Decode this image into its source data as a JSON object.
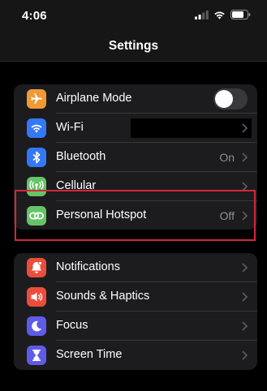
{
  "status_bar": {
    "time": "4:06"
  },
  "nav": {
    "title": "Settings"
  },
  "group1": [
    {
      "name": "airplane-mode",
      "label": "Airplane Mode",
      "icon": "airplane-icon",
      "color": "#f09a37",
      "toggle": false
    },
    {
      "name": "wifi",
      "label": "Wi-Fi",
      "icon": "wifi-icon",
      "color": "#3478f6",
      "value": ""
    },
    {
      "name": "bluetooth",
      "label": "Bluetooth",
      "icon": "bluetooth-icon",
      "color": "#3478f6",
      "value": "On"
    },
    {
      "name": "cellular",
      "label": "Cellular",
      "icon": "cellular-icon",
      "color": "#65c466"
    },
    {
      "name": "personal-hotspot",
      "label": "Personal Hotspot",
      "icon": "hotspot-icon",
      "color": "#65c466",
      "value": "Off"
    }
  ],
  "group2": [
    {
      "name": "notifications",
      "label": "Notifications",
      "icon": "bell-icon",
      "color": "#eb4d3d"
    },
    {
      "name": "sounds-haptics",
      "label": "Sounds & Haptics",
      "icon": "speaker-icon",
      "color": "#eb4d3d"
    },
    {
      "name": "focus",
      "label": "Focus",
      "icon": "moon-icon",
      "color": "#5e5ce6"
    },
    {
      "name": "screen-time",
      "label": "Screen Time",
      "icon": "hourglass-icon",
      "color": "#5e5ce6"
    }
  ]
}
